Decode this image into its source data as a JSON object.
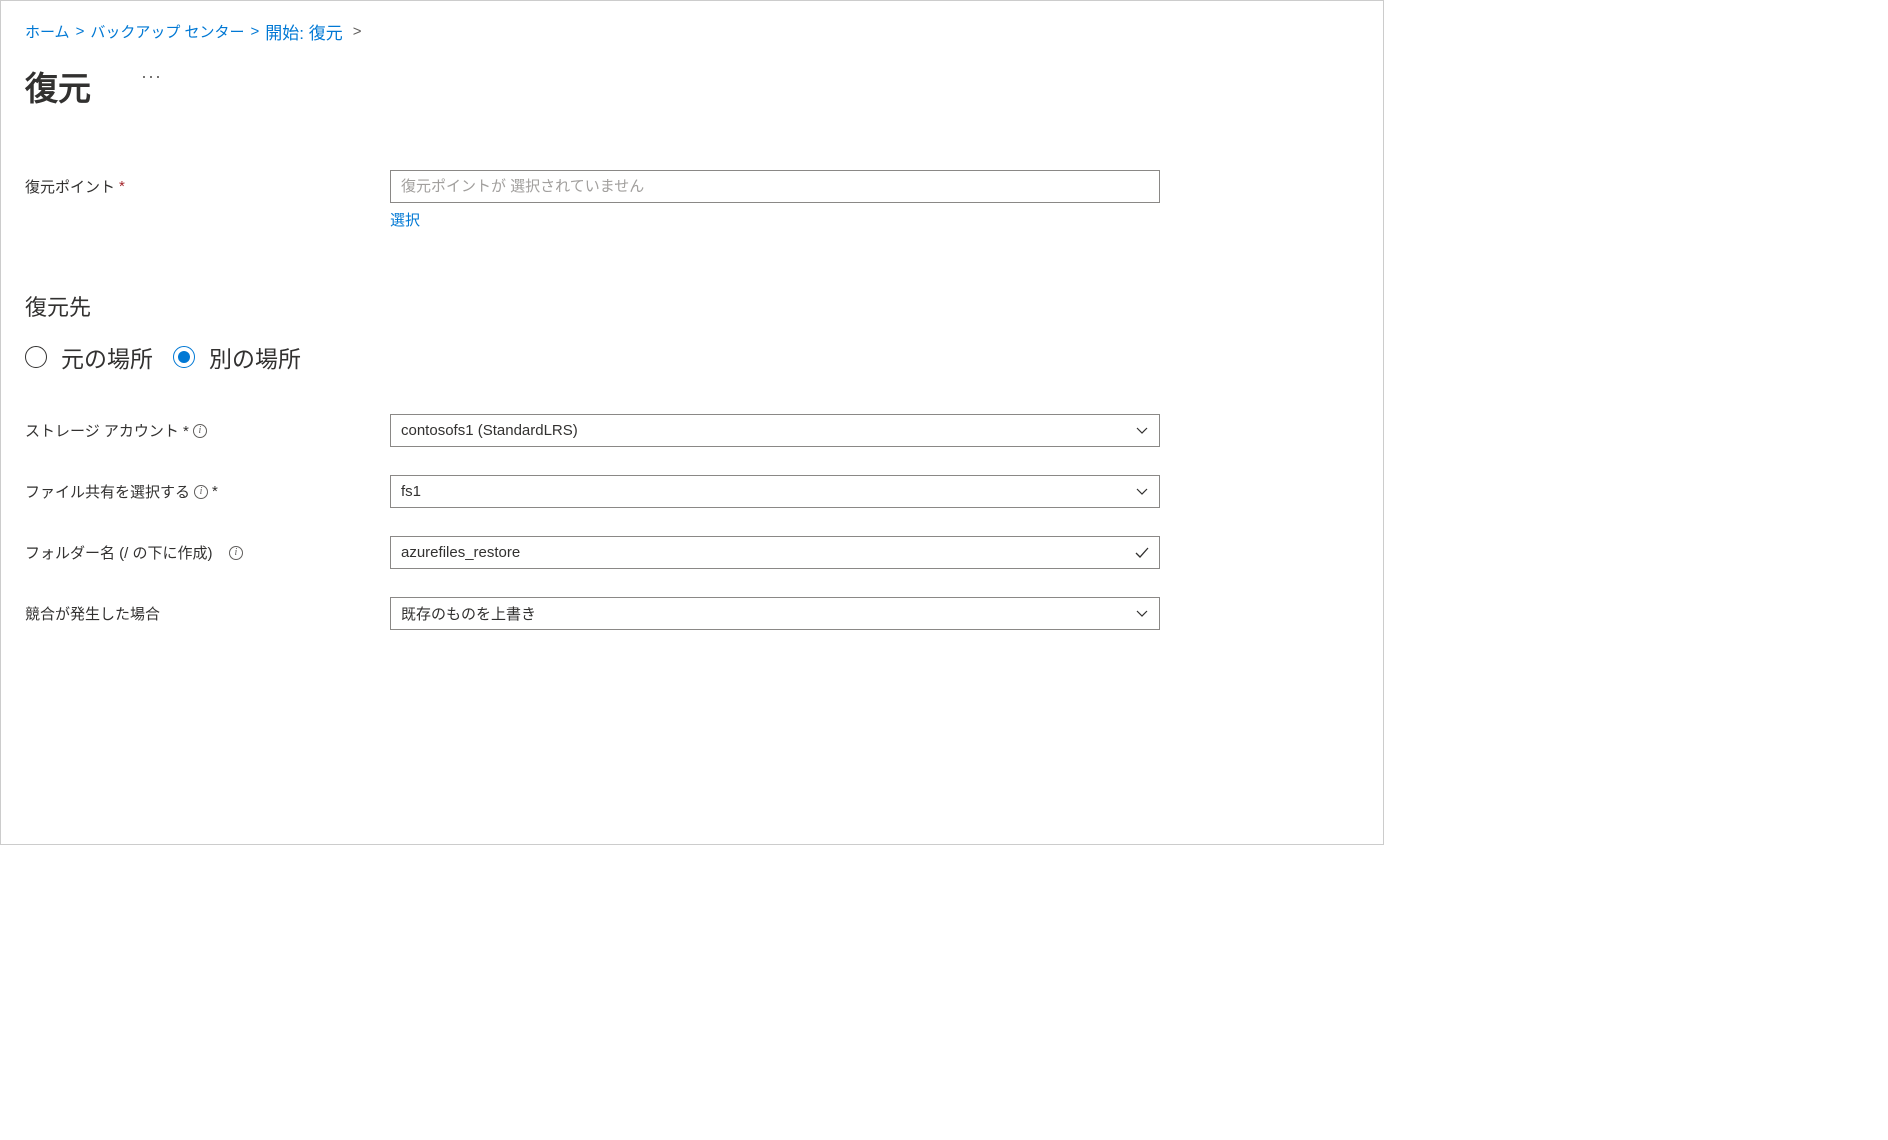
{
  "breadcrumb": {
    "home": "ホーム",
    "backup_center": "バックアップ センター",
    "current": "開始: 復元"
  },
  "page_title": "復元",
  "restore_point": {
    "label": "復元ポイント",
    "placeholder": "復元ポイントが 選択されていません",
    "select_link": "選択"
  },
  "destination": {
    "heading": "復元先",
    "original_location": "元の場所",
    "alternate_location": "別の場所"
  },
  "storage_account": {
    "label": "ストレージ アカウント *",
    "value": "contosofs1 (StandardLRS)"
  },
  "file_share": {
    "label": "ファイル共有を選択する",
    "value": "fs1"
  },
  "folder_name": {
    "label": "フォルダー名 (/ の下に作成)",
    "value": "azurefiles_restore"
  },
  "conflict": {
    "label": "競合が発生した場合",
    "value": "既存のものを上書き"
  }
}
